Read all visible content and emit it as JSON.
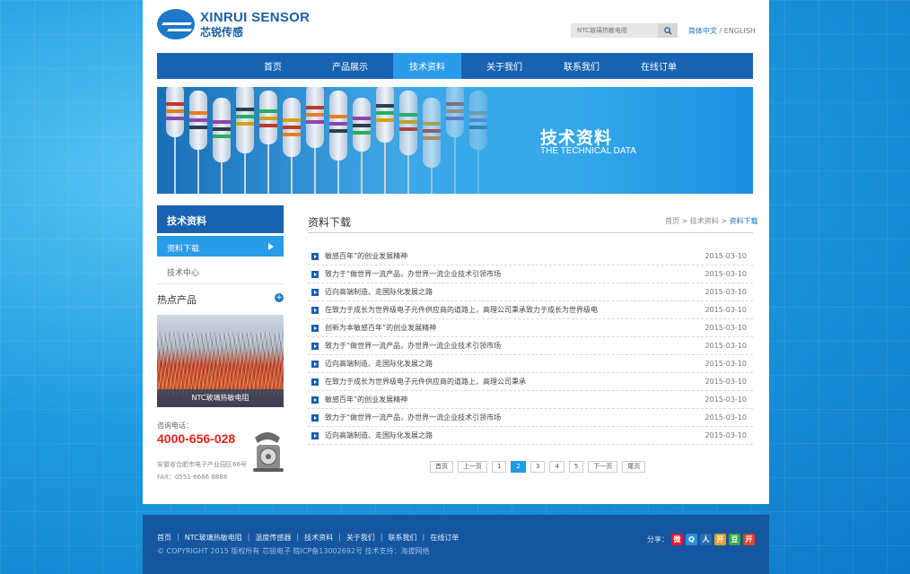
{
  "brand": {
    "name_en": "XINRUI SENSOR",
    "name_cn": "芯锐传感",
    "color": "#1d5fa6"
  },
  "search": {
    "placeholder": "NTC玻璃热敏电阻",
    "icon": "search-icon"
  },
  "lang": {
    "cn": "简体中文",
    "sep": " / ",
    "en": "ENGLISH"
  },
  "nav": {
    "items": [
      {
        "label": "首页",
        "active": false
      },
      {
        "label": "产品展示",
        "active": false
      },
      {
        "label": "技术资料",
        "active": true
      },
      {
        "label": "关于我们",
        "active": false
      },
      {
        "label": "联系我们",
        "active": false
      },
      {
        "label": "在线订单",
        "active": false
      }
    ],
    "bg": "#1763b2",
    "active_bg": "#2a9be8"
  },
  "banner": {
    "title": "技术资料",
    "subtitle": "THE TECHNICAL DATA"
  },
  "sidebar": {
    "heading": "技术资料",
    "items": [
      {
        "label": "资料下载",
        "active": true
      },
      {
        "label": "技术中心",
        "active": false
      }
    ],
    "hot_title": "热点产品",
    "hot_caption": "NTC玻璃热敏电阻",
    "consult_label": "咨询电话：",
    "phone": "4000-656-028",
    "address": "安徽省合肥市电子产业园区66号",
    "fax": "FAX：0551-6666 8888"
  },
  "content": {
    "title": "资料下载",
    "breadcrumb": {
      "home": "首页",
      "sep": " > ",
      "section": "技术资料",
      "current": "资料下载"
    },
    "rows": [
      {
        "title": "敏感百年”的创业发展精神",
        "date": "2015-03-10"
      },
      {
        "title": "致力于“做世界一流产品，办世界一流企业技术引领市场",
        "date": "2015-03-10"
      },
      {
        "title": "迈向高端制造、走国际化发展之路",
        "date": "2015-03-10"
      },
      {
        "title": "在致力于成长为世界级电子元件供应商的道路上，高理公司秉承致力于成长为世界级电",
        "date": "2015-03-10"
      },
      {
        "title": "创新为本敏感百年”的创业发展精神",
        "date": "2015-03-10"
      },
      {
        "title": "致力于“做世界一流产品，办世界一流企业技术引领市场",
        "date": "2015-03-10"
      },
      {
        "title": "迈向高端制造、走国际化发展之路",
        "date": "2015-03-10"
      },
      {
        "title": "在致力于成长为世界级电子元件供应商的道路上，高理公司秉承",
        "date": "2015-03-10"
      },
      {
        "title": "敏感百年”的创业发展精神",
        "date": "2015-03-10"
      },
      {
        "title": "致力于“做世界一流产品，办世界一流企业技术引领市场",
        "date": "2015-03-10"
      },
      {
        "title": "迈向高端制造、走国际化发展之路",
        "date": "2015-03-10"
      }
    ]
  },
  "pager": {
    "items": [
      {
        "label": "首页",
        "active": false
      },
      {
        "label": "上一页",
        "active": false
      },
      {
        "label": "1",
        "active": false
      },
      {
        "label": "2",
        "active": true
      },
      {
        "label": "3",
        "active": false
      },
      {
        "label": "4",
        "active": false
      },
      {
        "label": "5",
        "active": false
      },
      {
        "label": "下一页",
        "active": false
      },
      {
        "label": "尾页",
        "active": false
      }
    ]
  },
  "footer": {
    "links": [
      "首页",
      "NTC玻璃热敏电阻",
      "温度传感器",
      "技术资料",
      "关于我们",
      "联系我们",
      "在线订单"
    ],
    "link_sep": "|",
    "copyright": "© COPYRIGHT 2015 版权所有 芯锐电子 皖ICP备13002692号 技术支持：海拔网络",
    "share_label": "分享：",
    "share_icons": [
      {
        "name": "weibo-icon",
        "glyph": "微",
        "color": "#e6162d"
      },
      {
        "name": "qzone-icon",
        "glyph": "Q",
        "color": "#2b8fd9"
      },
      {
        "name": "renren-icon",
        "glyph": "人",
        "color": "#2d6cb5"
      },
      {
        "name": "kaixin-icon",
        "glyph": "开",
        "color": "#e2a22a"
      },
      {
        "name": "douban-icon",
        "glyph": "豆",
        "color": "#3ba94a"
      },
      {
        "name": "kaixin001-icon",
        "glyph": "开",
        "color": "#e2412a"
      }
    ]
  }
}
